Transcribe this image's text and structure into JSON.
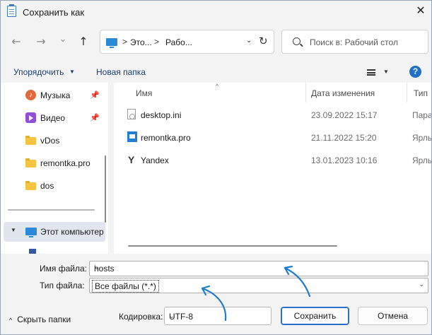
{
  "window": {
    "title": "Сохранить как",
    "close_glyph": "✕"
  },
  "nav": {
    "back_glyph": "←",
    "forward_glyph": "→",
    "recent_glyph": "⌄",
    "up_glyph": "↑",
    "address": {
      "segments": [
        "Это...",
        "Рабо..."
      ],
      "separator": ">",
      "dropdown_glyph": "⌄",
      "refresh_glyph": "↻"
    },
    "search_placeholder": "Поиск в: Рабочий стол"
  },
  "commandbar": {
    "organize": "Упорядочить",
    "organize_arrow": "▼",
    "new_folder": "Новая папка",
    "view_arrow": "▼",
    "help": "?"
  },
  "sidebar": {
    "items": [
      {
        "label": "Музыка",
        "icon": "music-icon",
        "pinned": true
      },
      {
        "label": "Видео",
        "icon": "video-icon",
        "pinned": true
      },
      {
        "label": "vDos",
        "icon": "folder-icon",
        "pinned": false
      },
      {
        "label": "remontka.pro",
        "icon": "folder-icon",
        "pinned": false
      },
      {
        "label": "dos",
        "icon": "folder-icon",
        "pinned": false
      }
    ],
    "pin_glyph": "📌",
    "this_pc": {
      "label": "Этот компьютер",
      "expand_glyph": "▼"
    }
  },
  "filelist": {
    "columns": {
      "name": "Имя",
      "modified": "Дата изменения",
      "type": "Тип"
    },
    "sort_glyph": "^",
    "rows": [
      {
        "name": "desktop.ini",
        "modified": "23.09.2022 15:17",
        "type": "Параметры конфигурации",
        "icon": "ini-file-icon"
      },
      {
        "name": "remontka.pro",
        "modified": "21.11.2022 15:20",
        "type": "Ярлык",
        "icon": "shortcut-icon"
      },
      {
        "name": "Yandex",
        "modified": "13.01.2023 10:16",
        "type": "Ярлык",
        "icon": "yandex-icon"
      }
    ]
  },
  "form": {
    "filename_label": "Имя файла:",
    "filename_value": "hosts",
    "filetype_label": "Тип файла:",
    "filetype_value": "Все файлы  (*.*)",
    "dropdown_glyph": "⌄"
  },
  "footer": {
    "hide_folders": "Скрыть папки",
    "hide_folders_glyph": "^",
    "encoding_label": "Кодировка:",
    "encoding_value": "UTF-8",
    "save": "Сохранить",
    "cancel": "Отмена"
  },
  "annotation": {
    "arrow_color": "#1e7bd0"
  }
}
